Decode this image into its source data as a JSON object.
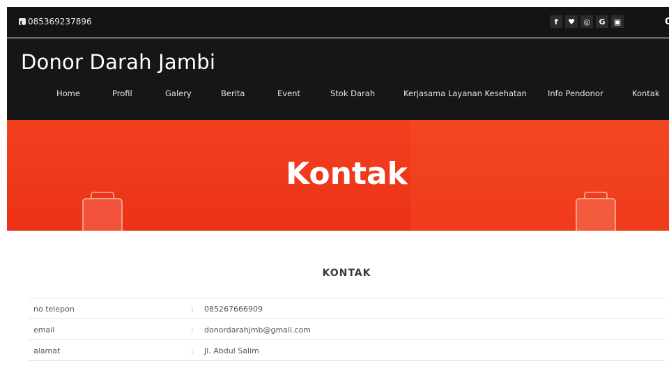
{
  "topbar": {
    "phone": "085369237896",
    "socials": [
      {
        "icon": "facebook-icon",
        "glyph": "f"
      },
      {
        "icon": "twitter-icon",
        "glyph": "♥"
      },
      {
        "icon": "instagram-icon",
        "glyph": "◎"
      },
      {
        "icon": "google-icon",
        "glyph": "G"
      },
      {
        "icon": "youtube-icon",
        "glyph": "▣"
      }
    ],
    "search_glyph": "Q"
  },
  "header": {
    "brand": "Donor Darah Jambi",
    "nav": [
      {
        "label": "Home",
        "key": "home"
      },
      {
        "label": "Profil",
        "key": "profil"
      },
      {
        "label": "Galery",
        "key": "galery"
      },
      {
        "label": "Berita",
        "key": "berita"
      },
      {
        "label": "Event",
        "key": "event"
      },
      {
        "label": "Stok Darah",
        "key": "stok-darah"
      },
      {
        "label": "Kerjasama Layanan Kesehatan",
        "key": "kerjasama"
      },
      {
        "label": "Info Pendonor",
        "key": "info-pendonor"
      },
      {
        "label": "Kontak",
        "key": "kontak"
      }
    ]
  },
  "hero": {
    "title": "Kontak"
  },
  "contact": {
    "section_title": "KONTAK",
    "rows": [
      {
        "label": "no telepon",
        "sep": ":",
        "value": "085267666909"
      },
      {
        "label": "email",
        "sep": ":",
        "value": "donordarahjmb@gmail.com"
      },
      {
        "label": "alamat",
        "sep": ":",
        "value": "Jl. Abdul Salim"
      }
    ]
  },
  "colors": {
    "header_bg": "#161616",
    "hero_red": "#f2401f",
    "text_dark": "#3a3a3a"
  }
}
